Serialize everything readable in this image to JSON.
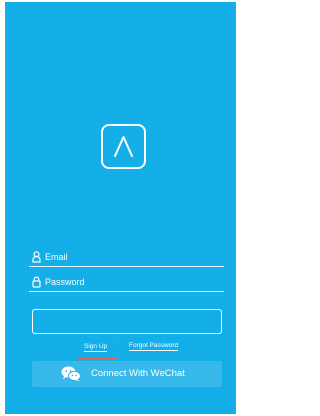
{
  "login": {
    "email_label": "Email",
    "password_label": "Password"
  },
  "links": {
    "signup_label": "Sign Up",
    "forgot_label": "Forgot Password"
  },
  "wechat": {
    "label": "Connect With WeChat"
  },
  "icons": {
    "logo": "lambda-logo-icon",
    "email": "user-icon",
    "password": "lock-icon",
    "wechat": "wechat-icon"
  },
  "colors": {
    "background": "#14aee8",
    "highlight": "#e06a4a",
    "text": "#ffffff"
  }
}
